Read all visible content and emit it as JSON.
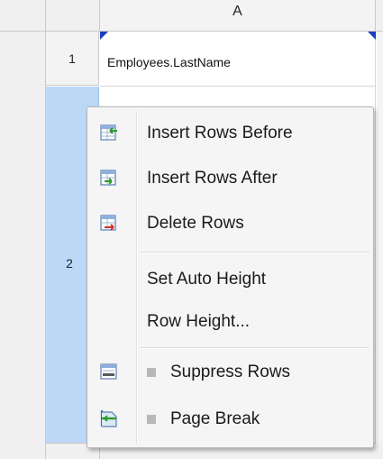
{
  "grid": {
    "column_header": "A",
    "rows": [
      {
        "number": "1",
        "cell_value": "Employees.LastName"
      },
      {
        "number": "2",
        "cell_value": ""
      }
    ]
  },
  "context_menu": {
    "items": [
      {
        "label": "Insert Rows Before",
        "icon": "insert-rows-before-icon"
      },
      {
        "label": "Insert Rows After",
        "icon": "insert-rows-after-icon"
      },
      {
        "label": "Delete Rows",
        "icon": "delete-rows-icon"
      },
      {
        "label": "Set Auto Height",
        "icon": ""
      },
      {
        "label": "Row Height...",
        "icon": ""
      },
      {
        "label": "Suppress Rows",
        "icon": "suppress-rows-icon",
        "checkbox": "unchecked"
      },
      {
        "label": "Page Break",
        "icon": "page-break-icon",
        "checkbox": "unchecked"
      }
    ]
  },
  "colors": {
    "selected_row_header": "#bcd8f6",
    "cell_marker": "#1b3fbf",
    "menu_background": "#f5f5f5"
  }
}
